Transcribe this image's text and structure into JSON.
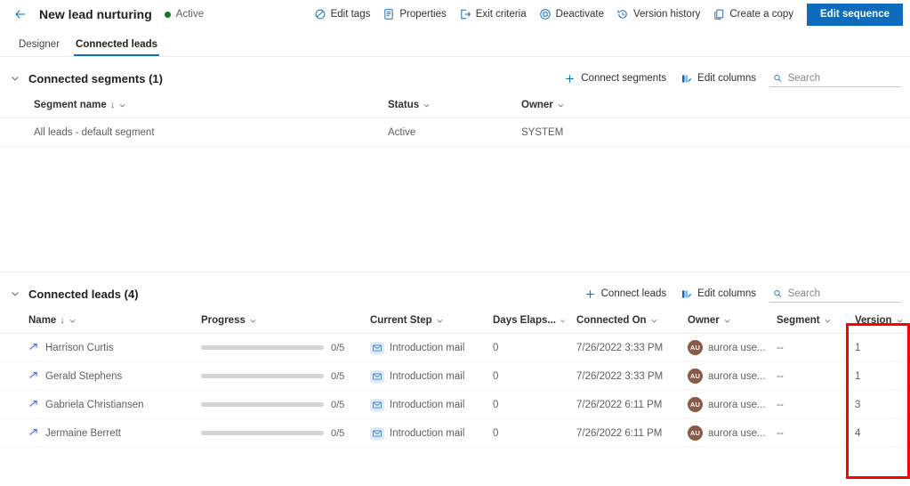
{
  "header": {
    "back_icon": "back-arrow-icon",
    "title": "New lead nurturing",
    "status": "Active",
    "status_color": "#107c10",
    "accent_color": "#0f6cbd",
    "commands": [
      {
        "label": "Edit tags",
        "icon": "tag-icon"
      },
      {
        "label": "Properties",
        "icon": "document-properties-icon"
      },
      {
        "label": "Exit criteria",
        "icon": "exit-icon"
      },
      {
        "label": "Deactivate",
        "icon": "deactivate-circle-icon"
      },
      {
        "label": "Version history",
        "icon": "history-clock-icon"
      },
      {
        "label": "Create a copy",
        "icon": "copy-icon"
      }
    ],
    "primary_button": "Edit sequence"
  },
  "tabs": [
    {
      "label": "Designer",
      "active": false
    },
    {
      "label": "Connected leads",
      "active": true
    }
  ],
  "segments_section": {
    "title": "Connected segments (1)",
    "collapse_icon": "chevron-down-icon",
    "actions": [
      {
        "label": "Connect segments",
        "icon": "plus-icon"
      },
      {
        "label": "Edit columns",
        "icon": "edit-columns-icon"
      }
    ],
    "search_placeholder": "Search",
    "search_value": "",
    "columns": [
      {
        "label": "Segment name",
        "sorted": true
      },
      {
        "label": "Status",
        "sorted": false
      },
      {
        "label": "Owner",
        "sorted": false
      }
    ],
    "rows": [
      {
        "name": "All leads - default segment",
        "status": "Active",
        "owner": "SYSTEM"
      }
    ]
  },
  "leads_section": {
    "title": "Connected leads (4)",
    "collapse_icon": "chevron-down-icon",
    "actions": [
      {
        "label": "Connect leads",
        "icon": "plus-icon"
      },
      {
        "label": "Edit columns",
        "icon": "edit-columns-icon"
      }
    ],
    "search_placeholder": "Search",
    "search_value": "",
    "columns": [
      {
        "label": "Name",
        "sorted": true
      },
      {
        "label": "Progress",
        "sorted": false
      },
      {
        "label": "Current Step",
        "sorted": false
      },
      {
        "label": "Days Elaps...",
        "sorted": false
      },
      {
        "label": "Connected On",
        "sorted": false
      },
      {
        "label": "Owner",
        "sorted": false
      },
      {
        "label": "Segment",
        "sorted": false
      },
      {
        "label": "Version",
        "sorted": false
      }
    ],
    "rows": [
      {
        "name": "Harrison Curtis",
        "progress_label": "0/5",
        "progress_pct": 0,
        "current_step": "Introduction mail",
        "days_elapsed": "0",
        "connected_on": "7/26/2022 3:33 PM",
        "owner": "aurora use...",
        "owner_initials": "AU",
        "segment": "--",
        "version": "1"
      },
      {
        "name": "Gerald Stephens",
        "progress_label": "0/5",
        "progress_pct": 0,
        "current_step": "Introduction mail",
        "days_elapsed": "0",
        "connected_on": "7/26/2022 3:33 PM",
        "owner": "aurora use...",
        "owner_initials": "AU",
        "segment": "--",
        "version": "1"
      },
      {
        "name": "Gabriela Christiansen",
        "progress_label": "0/5",
        "progress_pct": 0,
        "current_step": "Introduction mail",
        "days_elapsed": "0",
        "connected_on": "7/26/2022 6:11 PM",
        "owner": "aurora use...",
        "owner_initials": "AU",
        "segment": "--",
        "version": "3"
      },
      {
        "name": "Jermaine Berrett",
        "progress_label": "0/5",
        "progress_pct": 0,
        "current_step": "Introduction mail",
        "days_elapsed": "0",
        "connected_on": "7/26/2022 6:11 PM",
        "owner": "aurora use...",
        "owner_initials": "AU",
        "segment": "--",
        "version": "4"
      }
    ]
  },
  "annotation": {
    "color": "#ff0000",
    "target": "version-column"
  }
}
